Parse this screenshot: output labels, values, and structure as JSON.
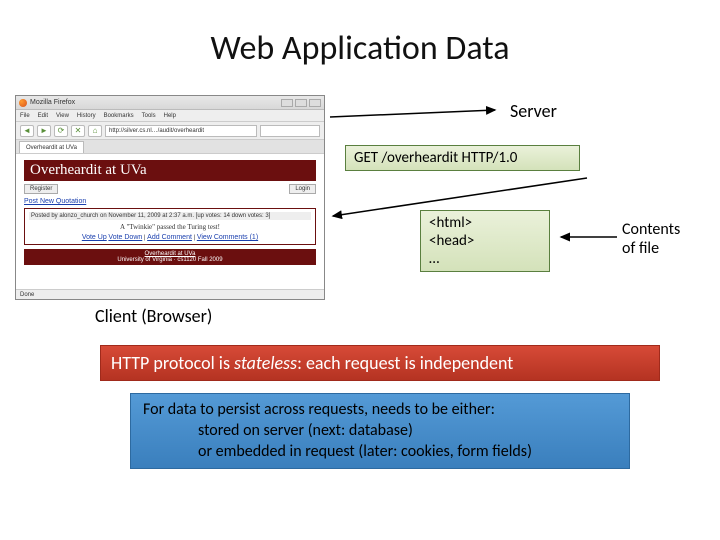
{
  "title": "Web Application Data",
  "server_label": "Server",
  "client_label": "Client (Browser)",
  "request_text": "GET /overheardit HTTP/1.0",
  "response": {
    "l1": "<html>",
    "l2": "<head>",
    "l3": "…"
  },
  "contents_label": {
    "l1": "Contents",
    "l2": "of file"
  },
  "red_bar_pre": "HTTP protocol is ",
  "red_bar_em": "stateless",
  "red_bar_post": ": each request is independent",
  "blue_box": {
    "l1": "For data to persist across requests, needs to be either:",
    "l2": "stored on server (next: database)",
    "l3": "or embedded in request (later: cookies, form fields)"
  },
  "browser": {
    "window_title": "Mozilla Firefox",
    "menus": [
      "File",
      "Edit",
      "View",
      "History",
      "Bookmarks",
      "Tools",
      "Help"
    ],
    "url": "http://silver.cs.nl…/audit/overheardit",
    "tab": "Overheardit at UVa",
    "header": "Overheardit at UVa",
    "register_btn": "Register",
    "login_btn": "Login",
    "new_quote_link": "Post New Quotation",
    "post_meta": "Posted by alonzo_church on November 11, 2009 at 2:37 a.m. [up votes: 14 down votes: 3]",
    "post_quote": "A \"Twinkie\" passed the Turing test!",
    "post_actions": [
      "Vote Up",
      "Vote Down",
      "Add Comment",
      "View Comments (1)"
    ],
    "footer_link": "Overheardit at UVa",
    "footer_sub": "University of Virginia · cs1120 Fall 2009",
    "status": "Done"
  }
}
